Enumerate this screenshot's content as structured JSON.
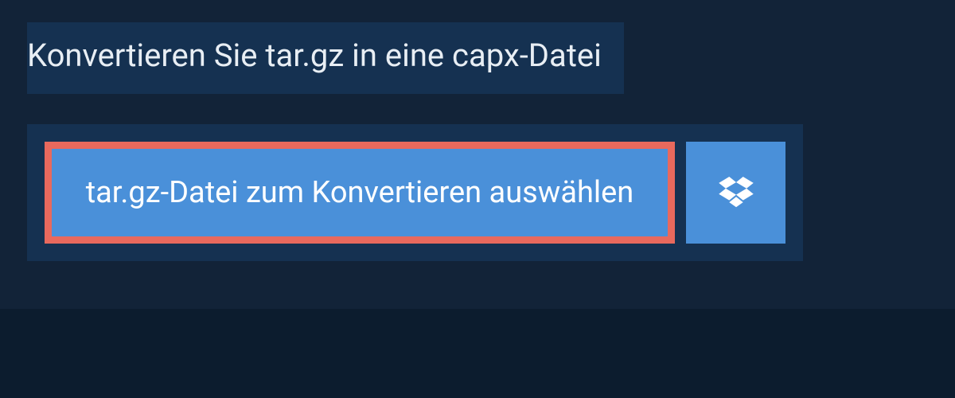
{
  "title": "Konvertieren Sie tar.gz in eine capx-Datei",
  "upload": {
    "select_label": "tar.gz-Datei zum Konvertieren auswählen",
    "cloud_provider": "dropbox"
  },
  "colors": {
    "accent": "#4a90d9",
    "highlight_border": "#e8695d",
    "panel_bg": "#153151",
    "page_bg": "#122338"
  }
}
